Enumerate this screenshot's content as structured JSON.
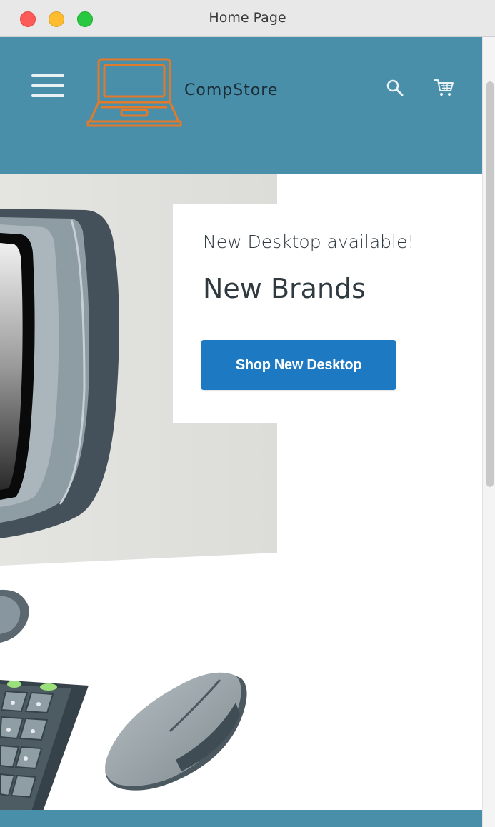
{
  "window": {
    "title": "Home Page"
  },
  "header": {
    "brand_name": "CompStore",
    "background_color": "#4a8fa9",
    "logo_color": "#e07a2c",
    "icons": {
      "menu": "hamburger-menu-icon",
      "search": "search-icon",
      "cart": "shopping-cart-icon"
    }
  },
  "hero": {
    "subtitle": "New Desktop available!",
    "title": "New Brands",
    "button_label": "Shop New Desktop",
    "button_color": "#1c79c2",
    "illustration": "desktop-computer-illustration"
  }
}
